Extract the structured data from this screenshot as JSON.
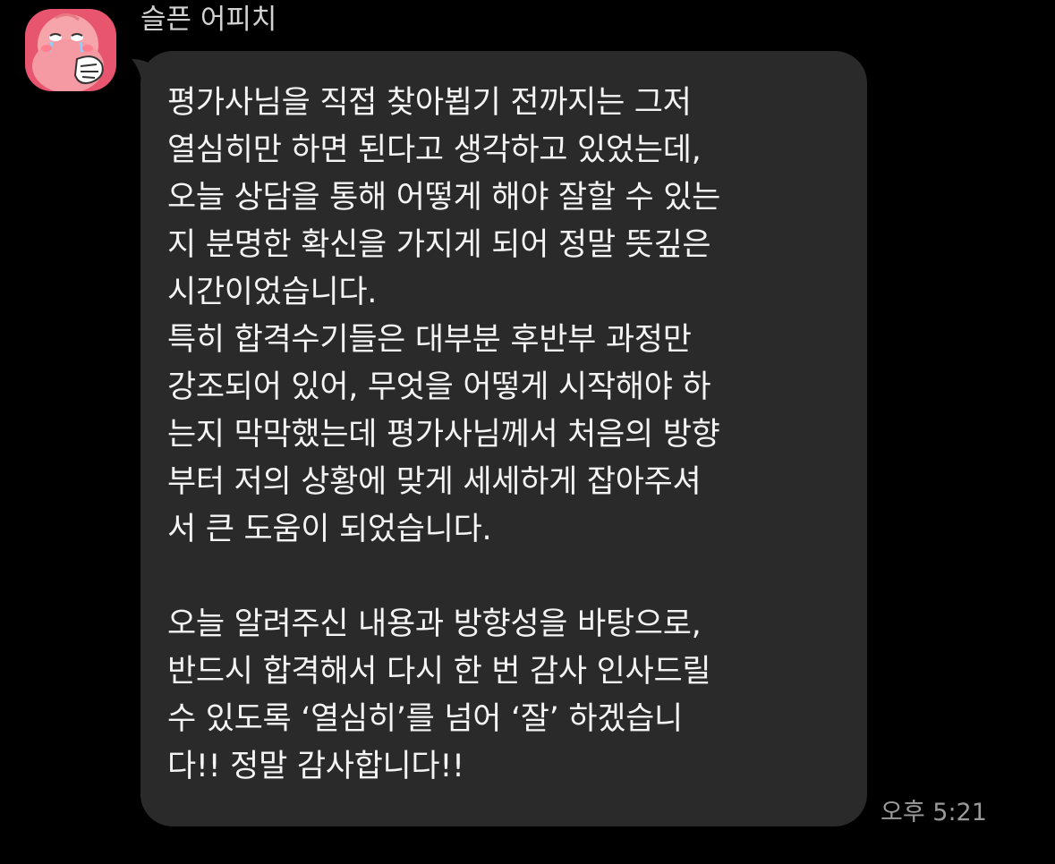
{
  "app": {
    "background_color": "#000000",
    "bubble_color": "#2a2a2a",
    "avatar_color": "#e8556f"
  },
  "message": {
    "sender": {
      "name": "슬픈 어피치",
      "avatar_icon": "peach-character-icon"
    },
    "lines": [
      "평가사님을 직접 찾아뵙기 전까지는 그저",
      "열심히만 하면 된다고 생각하고 있었는데,",
      "오늘 상담을 통해 어떻게 해야 잘할 수 있는",
      "지 분명한 확신을 가지게 되어 정말 뜻깊은",
      "시간이었습니다.",
      "특히 합격수기들은 대부분 후반부 과정만",
      "강조되어 있어, 무엇을 어떻게 시작해야 하",
      "는지 막막했는데 평가사님께서 처음의 방향",
      "부터 저의 상황에 맞게 세세하게 잡아주셔",
      "서 큰 도움이 되었습니다.",
      "",
      "오늘 알려주신 내용과 방향성을 바탕으로,",
      "반드시 합격해서 다시 한 번 감사 인사드릴",
      "수 있도록 ‘열심히’를 넘어 ‘잘’ 하겠습니",
      "다!! 정말 감사합니다!!"
    ],
    "timestamp": "오후 5:21"
  }
}
